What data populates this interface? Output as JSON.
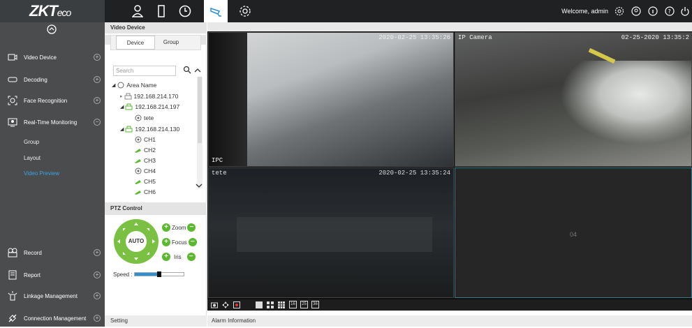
{
  "brand": {
    "name": "ZKT",
    "suffix": "eco"
  },
  "header": {
    "welcome": "Welcome, admin",
    "nav_icons": [
      "person-icon",
      "door-icon",
      "clock-icon",
      "camera-icon",
      "settings-icon"
    ],
    "right_icons": [
      "gear-icon",
      "user-circle-icon",
      "info-icon",
      "help-icon",
      "power-icon"
    ]
  },
  "sidebar": {
    "items": [
      {
        "label": "Video Device",
        "icon": "monitor-icon"
      },
      {
        "label": "Decoding",
        "icon": "decoder-icon"
      },
      {
        "label": "Face Recognition",
        "icon": "face-icon"
      },
      {
        "label": "Real-Time Monitoring",
        "icon": "screen-icon"
      },
      {
        "label": "Record",
        "icon": "record-icon"
      },
      {
        "label": "Report",
        "icon": "report-icon"
      },
      {
        "label": "Linkage Management",
        "icon": "linkage-icon"
      },
      {
        "label": "Connection Management",
        "icon": "link-icon"
      }
    ],
    "submenu": [
      "Group",
      "Layout",
      "Video Preview"
    ]
  },
  "video_device": {
    "title": "Video Device",
    "tabs": [
      "Device",
      "Group"
    ],
    "search_placeholder": "Search",
    "tree": {
      "root": "Area Name",
      "nodes": [
        "192.168.214.170",
        "192.168.214.197",
        "tete",
        "192.168.214.130",
        "CH1",
        "CH2",
        "CH3",
        "CH4",
        "CH5",
        "CH6"
      ]
    }
  },
  "ptz": {
    "title": "PTZ Control",
    "auto": "AUTO",
    "zoom": "Zoom",
    "focus": "Focus",
    "iris": "Iris",
    "speed_label": "Speed :",
    "speed_fraction": 0.5
  },
  "video": {
    "tiles": [
      {
        "timestamp": "2020-02-25 13:35:26",
        "label": "IPC"
      },
      {
        "camera": "IP Camera",
        "timestamp": "02-25-2020 13:35:2"
      },
      {
        "camera": "tete",
        "timestamp": "2020-02-25 13:35:24"
      },
      {
        "number": "04"
      }
    ],
    "toolbar_icons": [
      "snapshot-icon",
      "ptz-icon",
      "record-icon",
      "layout-1-icon",
      "layout-4-icon",
      "layout-9-icon",
      "layout-16-icon",
      "layout-25-icon",
      "layout-36-icon"
    ],
    "toolbar_labels": [
      "16",
      "25",
      "36"
    ]
  },
  "bottom": {
    "setting": "Setting",
    "alarm": "Alarm Information"
  },
  "colors": {
    "accent": "#3fa3e6",
    "ptz_green": "#7ac143",
    "sidebar_bg": "#4a4c4e",
    "topbar_bg": "#1f2122"
  }
}
